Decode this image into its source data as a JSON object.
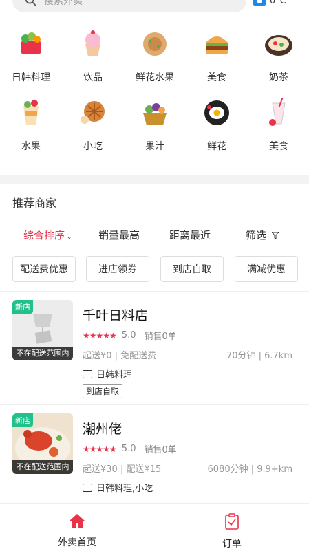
{
  "search": {
    "placeholder": "搜索外卖"
  },
  "weather": {
    "temp": "0°C"
  },
  "categories": [
    {
      "label": "日韩料理",
      "icon": "basket-icon"
    },
    {
      "label": "饮品",
      "icon": "cupcake-icon"
    },
    {
      "label": "鲜花水果",
      "icon": "pancake-icon"
    },
    {
      "label": "美食",
      "icon": "burger-icon"
    },
    {
      "label": "奶茶",
      "icon": "hotpot-icon"
    },
    {
      "label": "水果",
      "icon": "drink-cup-icon"
    },
    {
      "label": "小吃",
      "icon": "pie-icon"
    },
    {
      "label": "果汁",
      "icon": "fruit-basket-icon"
    },
    {
      "label": "鲜花",
      "icon": "egg-pan-icon"
    },
    {
      "label": "美食",
      "icon": "smoothie-icon"
    }
  ],
  "section_title": "推荐商家",
  "sort": {
    "comprehensive": "综合排序",
    "sales": "销量最高",
    "distance": "距离最近",
    "filter": "筛选"
  },
  "filters": [
    "配送费优惠",
    "进店领券",
    "到店自取",
    "满减优惠"
  ],
  "shops": [
    {
      "new_badge": "新店",
      "out_of_range": "不在配送范围内",
      "name": "千叶日料店",
      "score": "5.0",
      "sales": "销售0单",
      "delivery": "起送¥0 | 免配送费",
      "distance": "70分钟 | 6.7km",
      "tags": "日韩料理",
      "pickup": "到店自取"
    },
    {
      "new_badge": "新店",
      "out_of_range": "不在配送范围内",
      "name": "潮州佬",
      "score": "5.0",
      "sales": "销售0单",
      "delivery": "起送¥30 | 配送¥15",
      "distance": "6080分钟 | 9.9+km",
      "tags": "日韩料理,小吃"
    }
  ],
  "tabbar": {
    "home": "外卖首页",
    "orders": "订单"
  },
  "colors": {
    "accent": "#e8334a",
    "new_badge": "#21c18b"
  }
}
